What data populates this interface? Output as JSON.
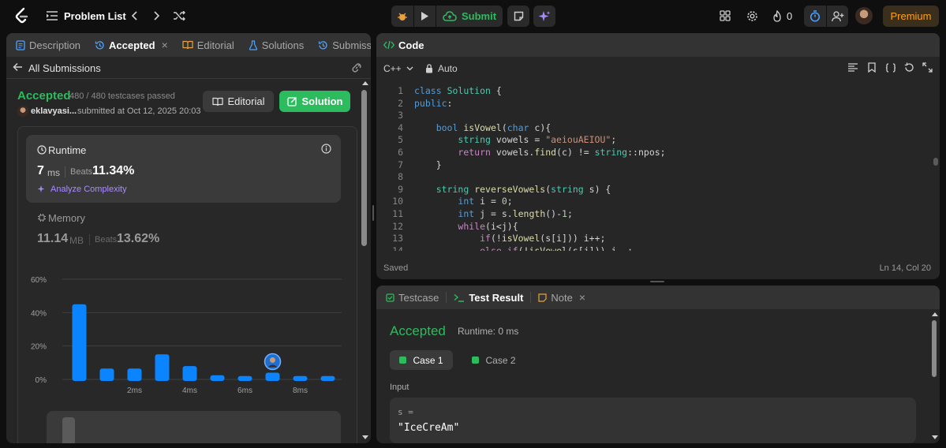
{
  "topbar": {
    "problem_list_label": "Problem List",
    "submit_label": "Submit",
    "streak_count": "0",
    "premium_label": "Premium"
  },
  "left_panel": {
    "tabs": [
      {
        "label": "Description",
        "icon": "description-icon"
      },
      {
        "label": "Accepted",
        "icon": "history-icon",
        "active": true
      },
      {
        "label": "Editorial",
        "icon": "book-icon"
      },
      {
        "label": "Solutions",
        "icon": "flask-icon"
      },
      {
        "label": "Submissions",
        "icon": "history-icon"
      }
    ],
    "back_label": "All Submissions",
    "status": "Accepted",
    "testcases": "480 / 480 testcases passed",
    "username": "eklavyasi...",
    "submitted_at": "submitted at Oct 12, 2025 20:03",
    "editorial_button": "Editorial",
    "solution_button": "Solution",
    "runtime": {
      "title": "Runtime",
      "value": "7",
      "unit": "ms",
      "beats_label": "Beats",
      "beats_value": "11.34%",
      "analyze_label": "Analyze Complexity"
    },
    "memory": {
      "title": "Memory",
      "value": "11.14",
      "unit": "MB",
      "beats_label": "Beats",
      "beats_value": "13.62%"
    }
  },
  "chart_data": {
    "type": "bar",
    "categories": [
      "0ms",
      "1ms",
      "2ms",
      "3ms",
      "4ms",
      "5ms",
      "6ms",
      "7ms",
      "8ms",
      "9ms"
    ],
    "values": [
      45,
      6.5,
      6.5,
      15,
      8,
      2.5,
      2,
      4,
      2,
      2
    ],
    "y_ticks": [
      "0%",
      "20%",
      "40%",
      "60%"
    ],
    "x_tick_labels": [
      "2ms",
      "4ms",
      "6ms",
      "8ms"
    ],
    "ylim": [
      0,
      60
    ],
    "highlight_category": "7ms",
    "bar_color": "#0a84ff"
  },
  "code_panel": {
    "title": "Code",
    "language": "C++",
    "mode": "Auto",
    "saved_label": "Saved",
    "cursor": "Ln 14, Col 20",
    "lines": [
      "class Solution {",
      "public:",
      "",
      "    bool isVowel(char c){",
      "        string vowels = \"aeiouAEIOU\";",
      "        return vowels.find(c) != string::npos;",
      "    }",
      "",
      "    string reverseVowels(string s) {",
      "        int i = 0;",
      "        int j = s.length()-1;",
      "        while(i<j){",
      "            if(!isVowel(s[i])) i++;",
      "            else if(!isVowel(s[j])) j--;"
    ]
  },
  "test_panel": {
    "tabs": [
      {
        "label": "Testcase",
        "icon": "check-box-icon"
      },
      {
        "label": "Test Result",
        "icon": "terminal-icon",
        "active": true
      },
      {
        "label": "Note",
        "icon": "note-icon"
      }
    ],
    "status": "Accepted",
    "runtime_text": "Runtime: 0 ms",
    "cases": [
      "Case 1",
      "Case 2"
    ],
    "input_label": "Input",
    "input_var": "s =",
    "input_value": "\"IceCreAm\""
  }
}
